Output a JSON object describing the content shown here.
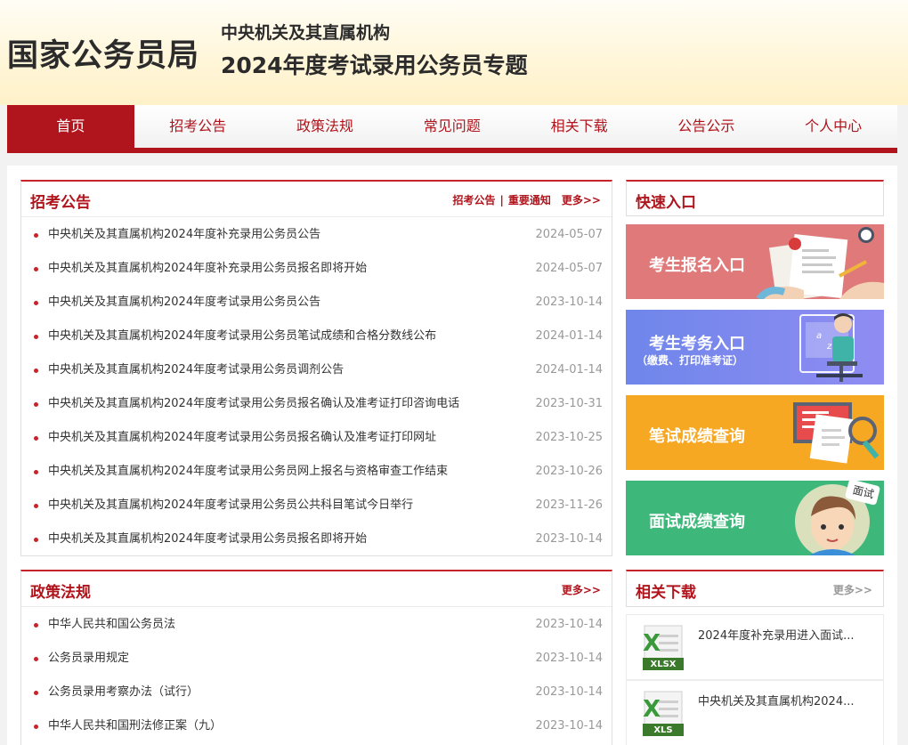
{
  "header": {
    "logo": "国家公务员局",
    "line1": "中央机关及其直属机构",
    "line2": "2024年度考试录用公务员专题"
  },
  "nav": [
    "首页",
    "招考公告",
    "政策法规",
    "常见问题",
    "相关下载",
    "公告公示",
    "个人中心"
  ],
  "recruit": {
    "title": "招考公告",
    "link1": "招考公告",
    "sep": "|",
    "link2": "重要通知",
    "more": "更多>>",
    "items": [
      {
        "title": "中央机关及其直属机构2024年度补充录用公务员公告",
        "date": "2024-05-07"
      },
      {
        "title": "中央机关及其直属机构2024年度补充录用公务员报名即将开始",
        "date": "2024-05-07"
      },
      {
        "title": "中央机关及其直属机构2024年度考试录用公务员公告",
        "date": "2023-10-14"
      },
      {
        "title": "中央机关及其直属机构2024年度考试录用公务员笔试成绩和合格分数线公布",
        "date": "2024-01-14"
      },
      {
        "title": "中央机关及其直属机构2024年度考试录用公务员调剂公告",
        "date": "2024-01-14"
      },
      {
        "title": "中央机关及其直属机构2024年度考试录用公务员报名确认及准考证打印咨询电话",
        "date": "2023-10-31"
      },
      {
        "title": "中央机关及其直属机构2024年度考试录用公务员报名确认及准考证打印网址",
        "date": "2023-10-25"
      },
      {
        "title": "中央机关及其直属机构2024年度考试录用公务员网上报名与资格审查工作结束",
        "date": "2023-10-26"
      },
      {
        "title": "中央机关及其直属机构2024年度考试录用公务员公共科目笔试今日举行",
        "date": "2023-11-26"
      },
      {
        "title": "中央机关及其直属机构2024年度考试录用公务员报名即将开始",
        "date": "2023-10-14"
      }
    ]
  },
  "policy": {
    "title": "政策法规",
    "more": "更多>>",
    "items": [
      {
        "title": "中华人民共和国公务员法",
        "date": "2023-10-14"
      },
      {
        "title": "公务员录用规定",
        "date": "2023-10-14"
      },
      {
        "title": "公务员录用考察办法（试行）",
        "date": "2023-10-14"
      },
      {
        "title": "中华人民共和国刑法修正案（九）",
        "date": "2023-10-14"
      }
    ]
  },
  "quick": {
    "title": "快速入口",
    "items": [
      {
        "label": "考生报名入口",
        "color": "#e07a7a"
      },
      {
        "label": "考生考务入口",
        "sub": "（缴费、打印准考证）",
        "color": "#6f86ea"
      },
      {
        "label": "笔试成绩查询",
        "color": "#f6a823"
      },
      {
        "label": "面试成绩查询",
        "badge": "面试",
        "color": "#3db87a"
      }
    ]
  },
  "downloads": {
    "title": "相关下载",
    "more": "更多>>",
    "items": [
      {
        "name": "2024年度补充录用进入面试...",
        "ext": "XLSX"
      },
      {
        "name": "中央机关及其直属机构2024...",
        "ext": "XLS"
      }
    ]
  }
}
